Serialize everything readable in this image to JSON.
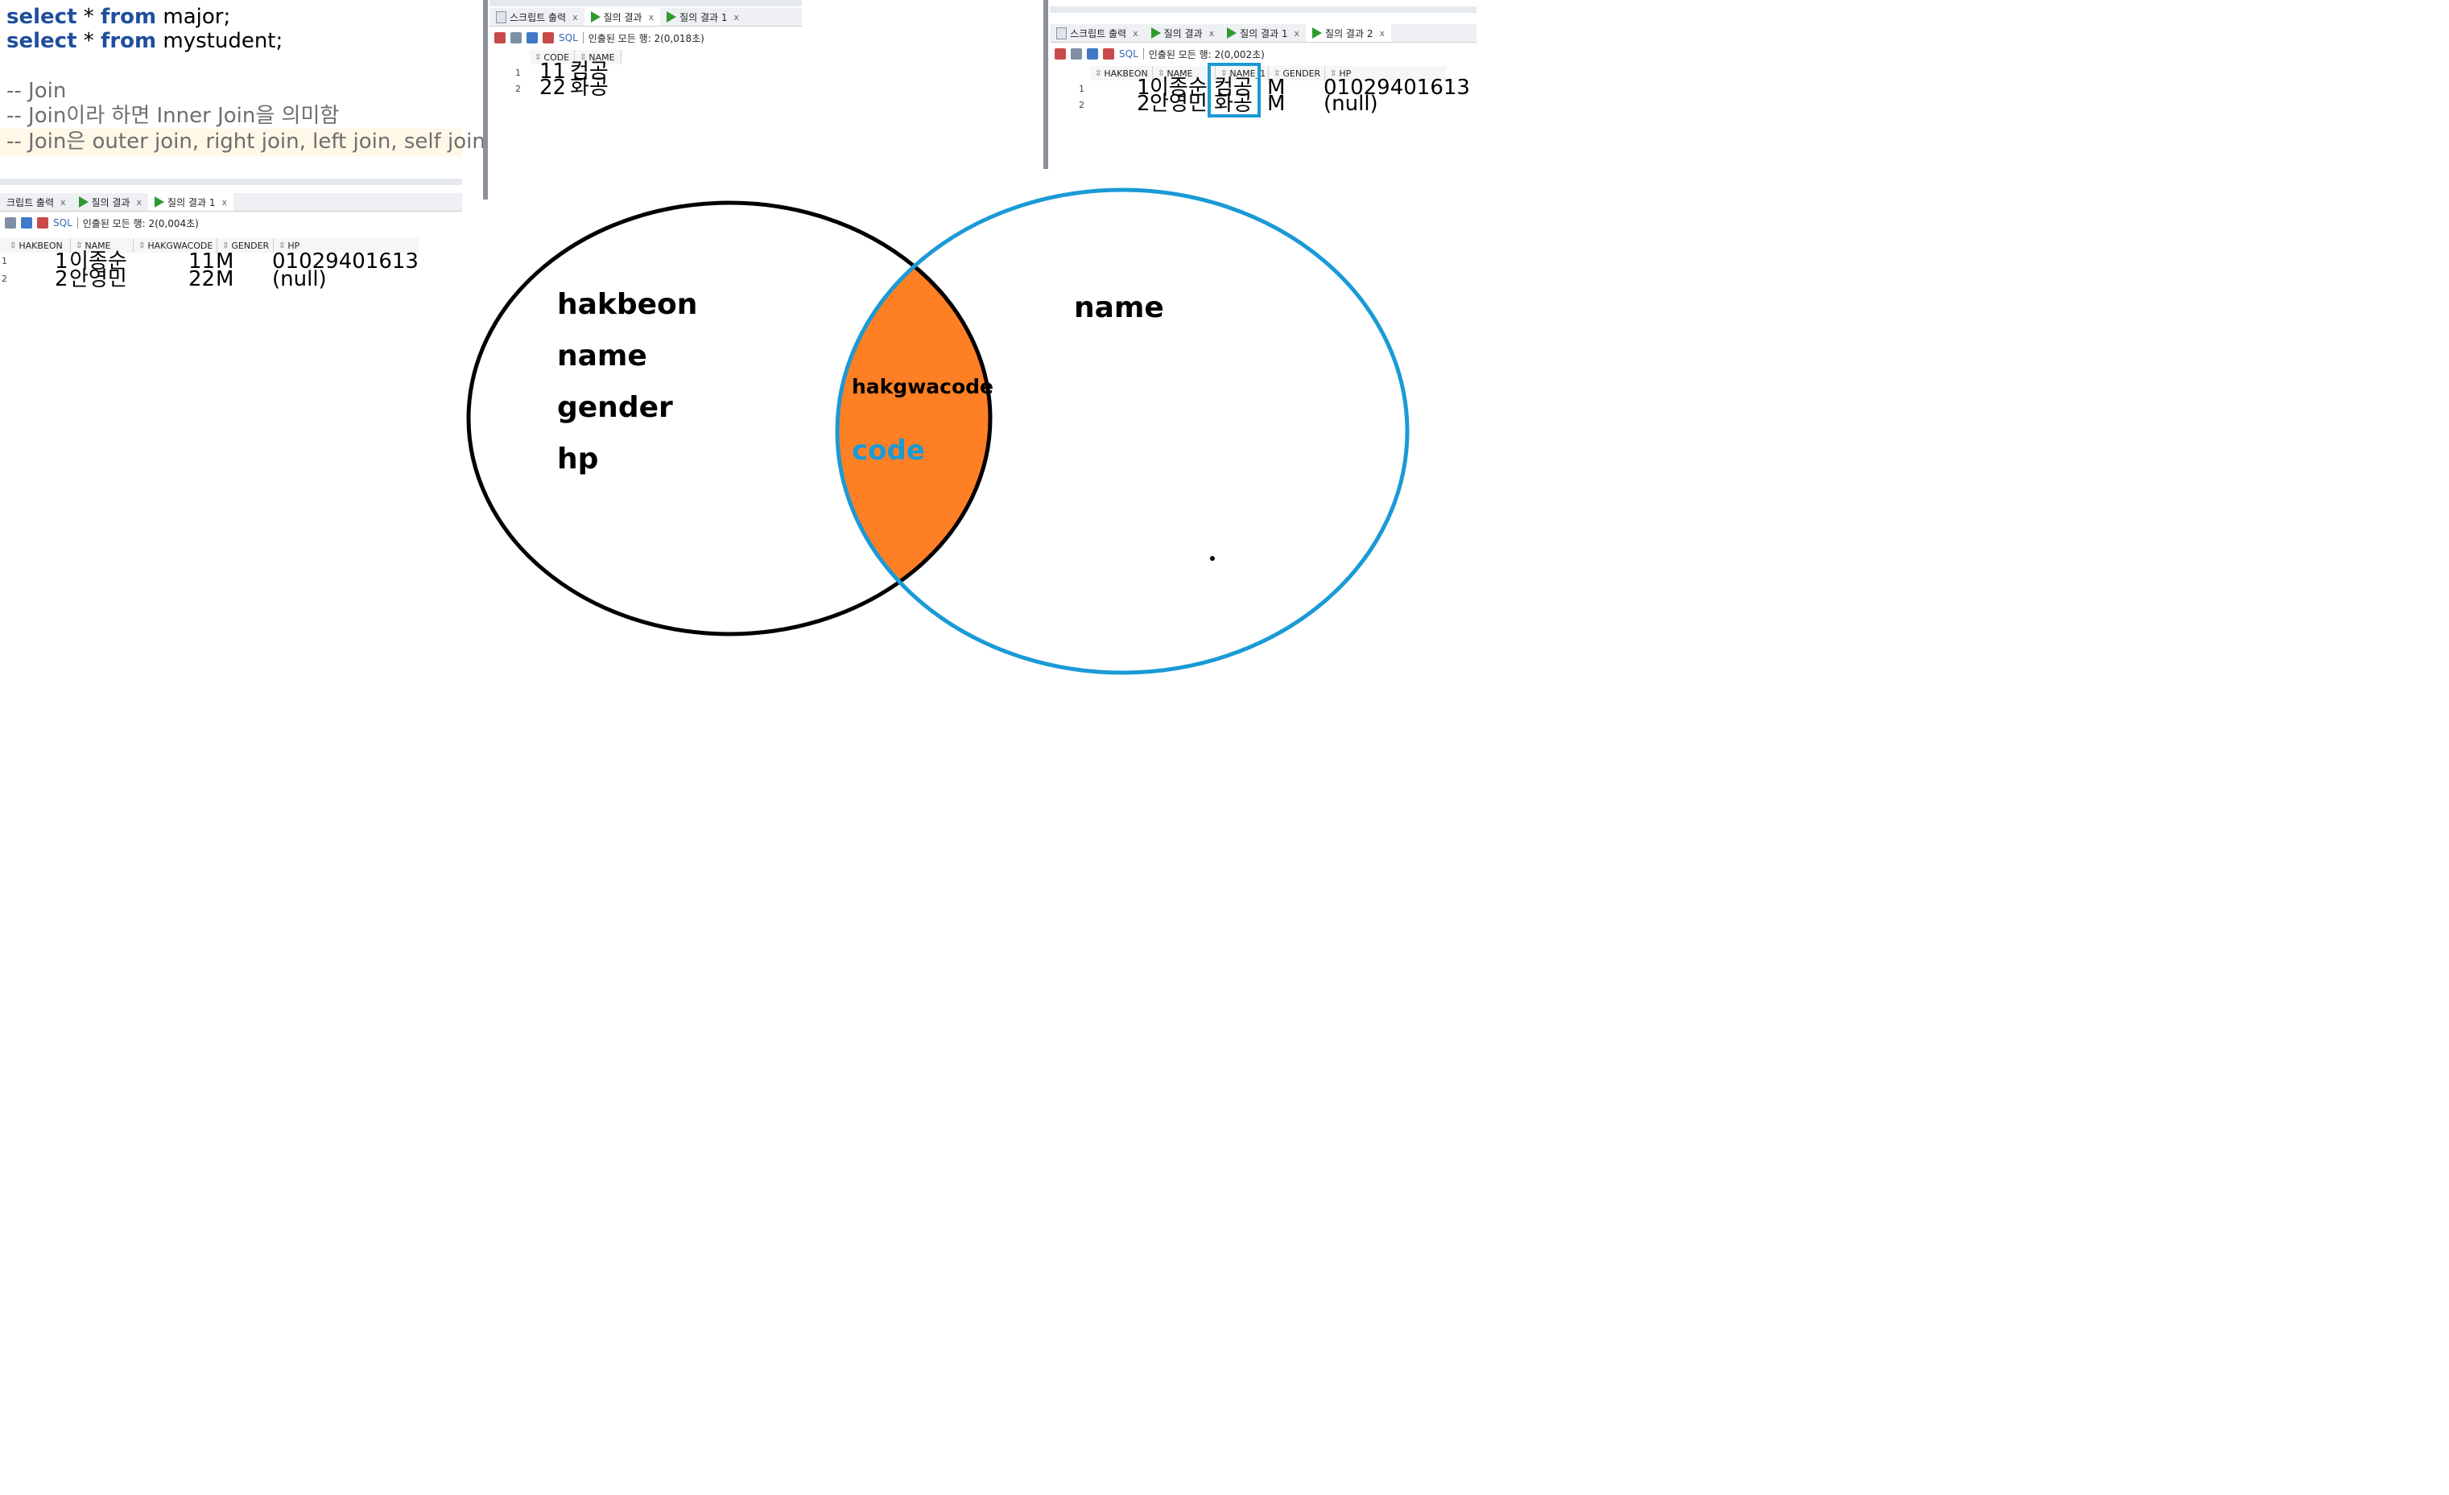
{
  "editor": {
    "line1": {
      "kw1": "select",
      "star": " * ",
      "kw2": "from",
      "rest": " major;"
    },
    "line2": {
      "kw1": "select",
      "star": " * ",
      "kw2": "from",
      "rest": " mystudent;"
    },
    "comment1": "-- Join",
    "comment2": "-- Join이라 하면 Inner Join을 의미함",
    "comment3": "-- Join은 outer join, right join, left join, self join"
  },
  "panel_left": {
    "tabs": [
      "크립트 출력",
      "질의 결과",
      "질의 결과 1"
    ],
    "sql_label": "SQL",
    "status": "인출된 모든 행: 2(0,004초)",
    "columns": [
      "HAKBEON",
      "NAME",
      "HAKGWACODE",
      "GENDER",
      "HP"
    ],
    "rows": [
      {
        "num": "1",
        "hakbeon": "1",
        "name": "이종순",
        "hakgwacode": "11",
        "gender": "M",
        "hp": "01029401613"
      },
      {
        "num": "2",
        "hakbeon": "2",
        "name": "안영민",
        "hakgwacode": "22",
        "gender": "M",
        "hp": "(null)"
      }
    ]
  },
  "panel_middle": {
    "tabs": [
      "스크립트 출력",
      "질의 결과",
      "질의 결과 1"
    ],
    "sql_label": "SQL",
    "status": "인출된 모든 행: 2(0,018초)",
    "columns": [
      "CODE",
      "NAME"
    ],
    "rows": [
      {
        "num": "1",
        "code": "11",
        "name": "컴공"
      },
      {
        "num": "2",
        "code": "22",
        "name": "화공"
      }
    ]
  },
  "panel_right": {
    "tabs": [
      "스크립트 출력",
      "질의 결과",
      "질의 결과 1",
      "질의 결과 2"
    ],
    "sql_label": "SQL",
    "status": "인출된 모든 행: 2(0,002초)",
    "columns": [
      "HAKBEON",
      "NAME",
      "NAME_1",
      "GENDER",
      "HP"
    ],
    "rows": [
      {
        "num": "1",
        "hakbeon": "1",
        "name": "이종순",
        "name_1": "컴공",
        "gender": "M",
        "hp": "01029401613"
      },
      {
        "num": "2",
        "hakbeon": "2",
        "name": "안영민",
        "name_1": "화공",
        "gender": "M",
        "hp": "(null)"
      }
    ]
  },
  "venn": {
    "left_set": [
      "hakbeon",
      "name",
      "gender",
      "hp"
    ],
    "right_set": [
      "name"
    ],
    "intersection_top": "hakgwacode",
    "intersection_bottom": "code",
    "colors": {
      "left_outline": "#000000",
      "right_outline": "#1a9ad6",
      "intersection_fill": "#fe7f24",
      "code_text": "#1a9ad6",
      "highlight_box": "#1a9ad6"
    }
  }
}
